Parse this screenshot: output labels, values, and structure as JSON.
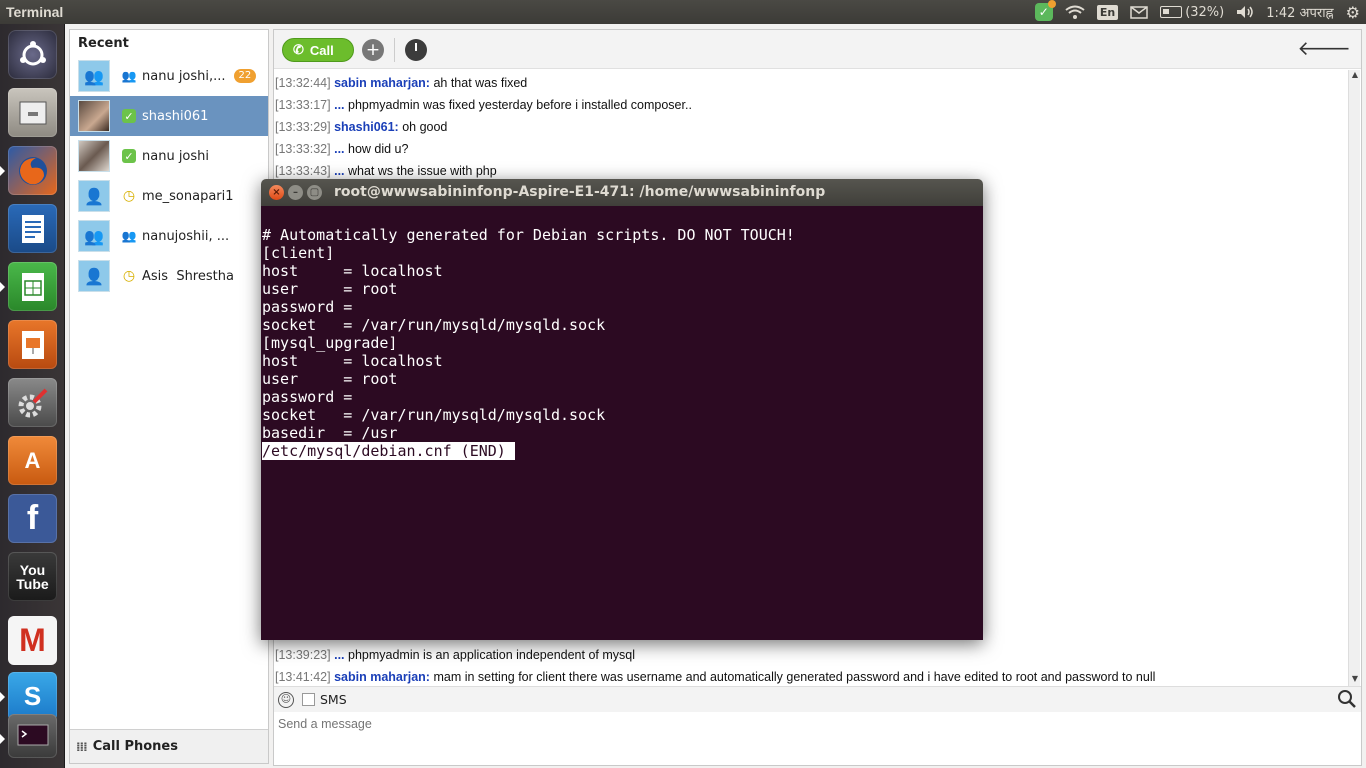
{
  "top_panel": {
    "app_title": "Terminal",
    "lang": "En",
    "battery": "(32%)",
    "time": "1:42 अपराह्न",
    "icons": [
      "skype-indicator-icon",
      "wifi-icon",
      "mail-icon",
      "battery-icon",
      "volume-icon",
      "settings-gear-icon"
    ]
  },
  "launcher": {
    "items": [
      {
        "name": "ubuntu-dash",
        "label": ""
      },
      {
        "name": "files",
        "label": ""
      },
      {
        "name": "firefox",
        "label": ""
      },
      {
        "name": "writer",
        "label": ""
      },
      {
        "name": "calc",
        "label": ""
      },
      {
        "name": "impress",
        "label": ""
      },
      {
        "name": "system-settings",
        "label": ""
      },
      {
        "name": "software-center",
        "label": "A"
      },
      {
        "name": "facebook",
        "label": "f"
      },
      {
        "name": "youtube",
        "label": "You Tube"
      },
      {
        "name": "gmail",
        "label": "M"
      },
      {
        "name": "skype",
        "label": "S"
      }
    ]
  },
  "contacts": {
    "header": "Recent",
    "items": [
      {
        "name": "nanu joshi,...",
        "status": "group",
        "badge": "22"
      },
      {
        "name": "shashi061",
        "status": "online",
        "badge": ""
      },
      {
        "name": "nanu joshi",
        "status": "online",
        "badge": ""
      },
      {
        "name": "me_sonapari1",
        "status": "away",
        "badge": ""
      },
      {
        "name": "nanujoshii, ...",
        "status": "group",
        "badge": ""
      },
      {
        "name": "Asis  Shrestha",
        "status": "away",
        "badge": ""
      }
    ],
    "footer": "Call Phones"
  },
  "toolbar": {
    "call_label": "Call"
  },
  "messages": [
    {
      "ts": "[13:32:44]",
      "sender": "sabin maharjan:",
      "text": "ah that was fixed"
    },
    {
      "ts": "[13:33:17]",
      "sender": "...",
      "text": "phpmyadmin was fixed yesterday before i installed composer.."
    },
    {
      "ts": "[13:33:29]",
      "sender": "shashi061:",
      "text": "oh good"
    },
    {
      "ts": "[13:33:32]",
      "sender": "...",
      "text": "how did u?"
    },
    {
      "ts": "[13:33:43]",
      "sender": "...",
      "text": "what ws the issue with php"
    }
  ],
  "messages_bottom": [
    {
      "ts": "[13:39:23]",
      "sender": "...",
      "text": "phpmyadmin is an application independent of mysql"
    },
    {
      "ts": "[13:41:42]",
      "sender": "sabin maharjan:",
      "text": "mam in setting for client there was username and automatically generated password and i have edited to root and password to null"
    }
  ],
  "compose": {
    "sms_label": "SMS",
    "placeholder": "Send a message"
  },
  "terminal": {
    "title": "root@wwwsabininfonp-Aspire-E1-471: /home/wwwsabininfonp",
    "lines": [
      "# Automatically generated for Debian scripts. DO NOT TOUCH!",
      "[client]",
      "host     = localhost",
      "user     = root",
      "password =",
      "socket   = /var/run/mysqld/mysqld.sock",
      "[mysql_upgrade]",
      "host     = localhost",
      "user     = root",
      "password =",
      "socket   = /var/run/mysqld/mysqld.sock",
      "basedir  = /usr"
    ],
    "status_line": "/etc/mysql/debian.cnf (END) "
  }
}
